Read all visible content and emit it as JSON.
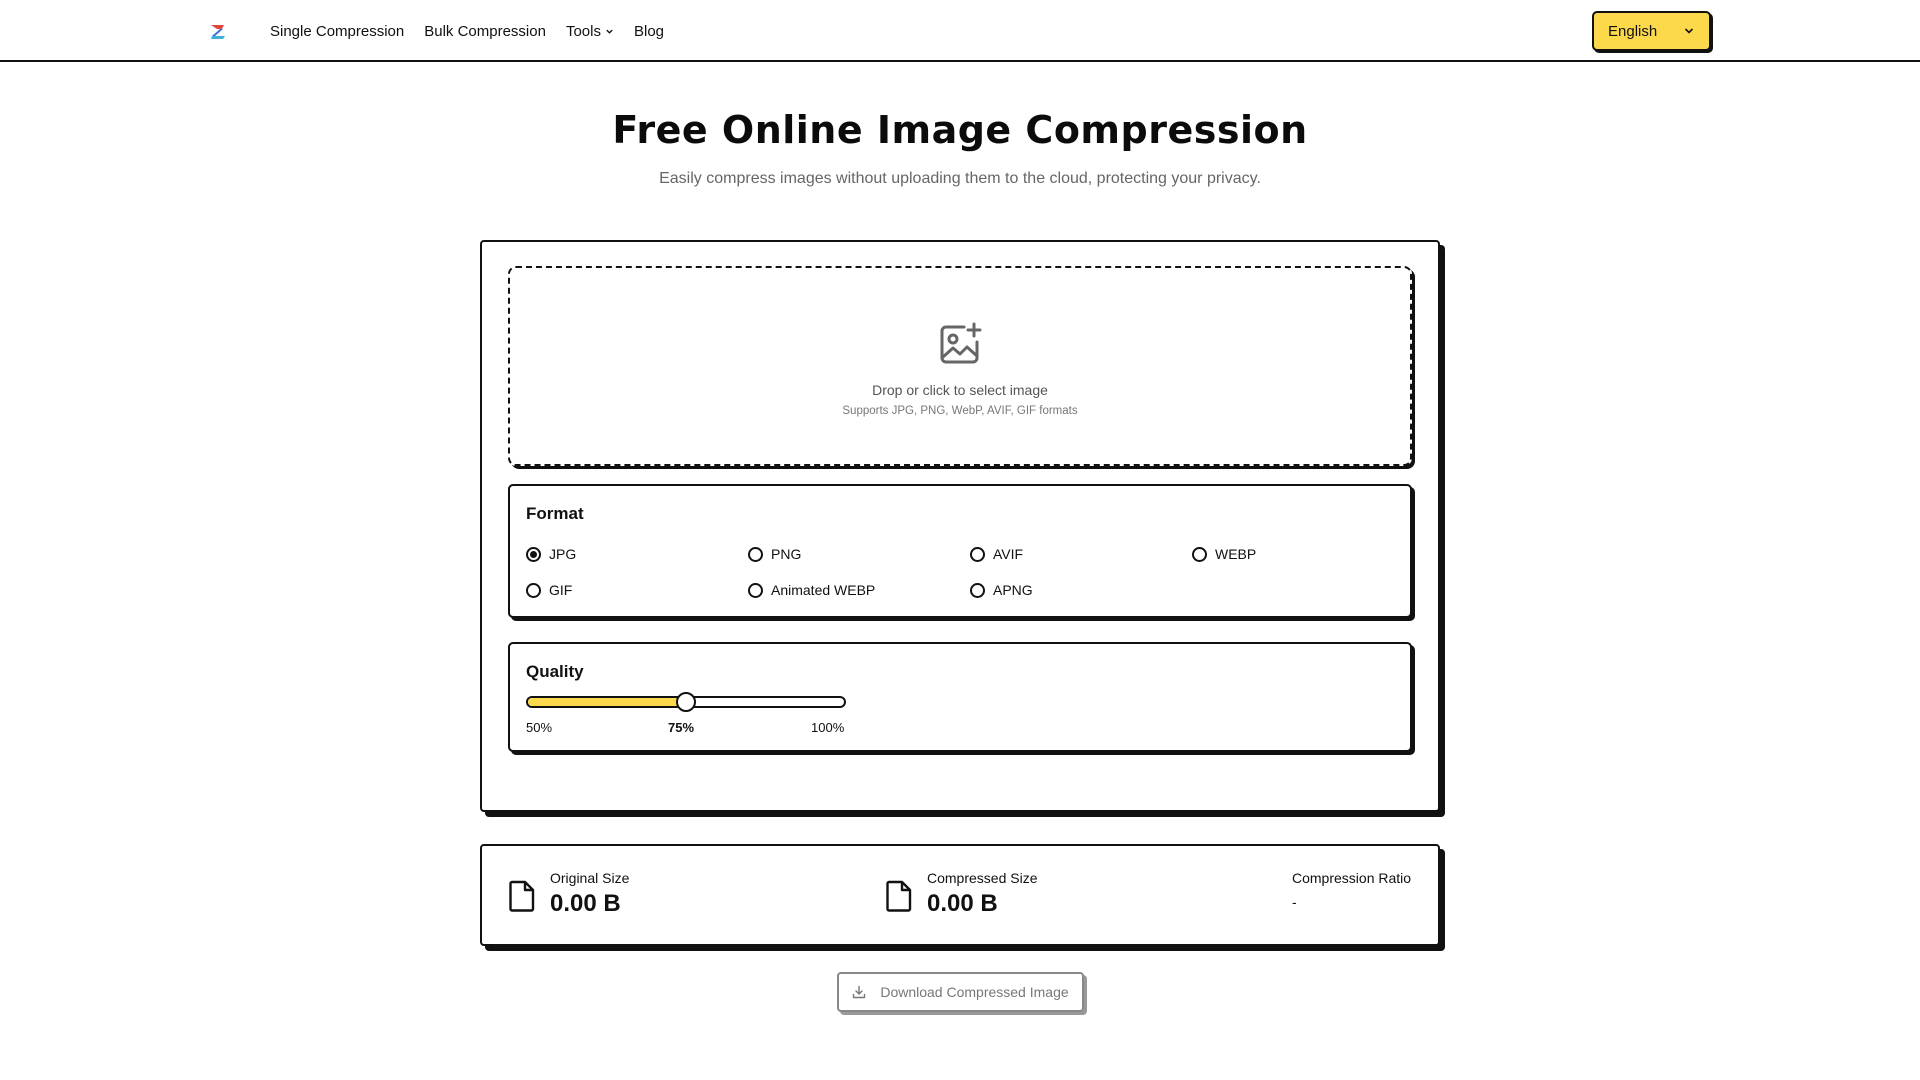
{
  "header": {
    "nav": [
      {
        "label": "Single Compression"
      },
      {
        "label": "Bulk Compression"
      },
      {
        "label": "Tools"
      },
      {
        "label": "Blog"
      }
    ],
    "language": "English"
  },
  "hero": {
    "title": "Free Online Image Compression",
    "subtitle": "Easily compress images without uploading them to the cloud, protecting your privacy."
  },
  "dropzone": {
    "title": "Drop or click to select image",
    "subtitle": "Supports JPG, PNG, WebP, AVIF, GIF formats"
  },
  "format": {
    "title": "Format",
    "selected": "JPG",
    "options": [
      "JPG",
      "PNG",
      "AVIF",
      "WEBP",
      "GIF",
      "Animated WEBP",
      "APNG"
    ]
  },
  "quality": {
    "title": "Quality",
    "min_label": "50%",
    "current_label": "75%",
    "max_label": "100%",
    "min": 50,
    "max": 100,
    "value": 75
  },
  "stats": {
    "original_label": "Original Size",
    "original_value": "0.00 B",
    "compressed_label": "Compressed Size",
    "compressed_value": "0.00 B",
    "ratio_label": "Compression Ratio",
    "ratio_value": "-"
  },
  "download": {
    "label": "Download Compressed Image"
  },
  "colors": {
    "accent": "#fcd94a",
    "border": "#111111",
    "muted_text": "#666666"
  }
}
